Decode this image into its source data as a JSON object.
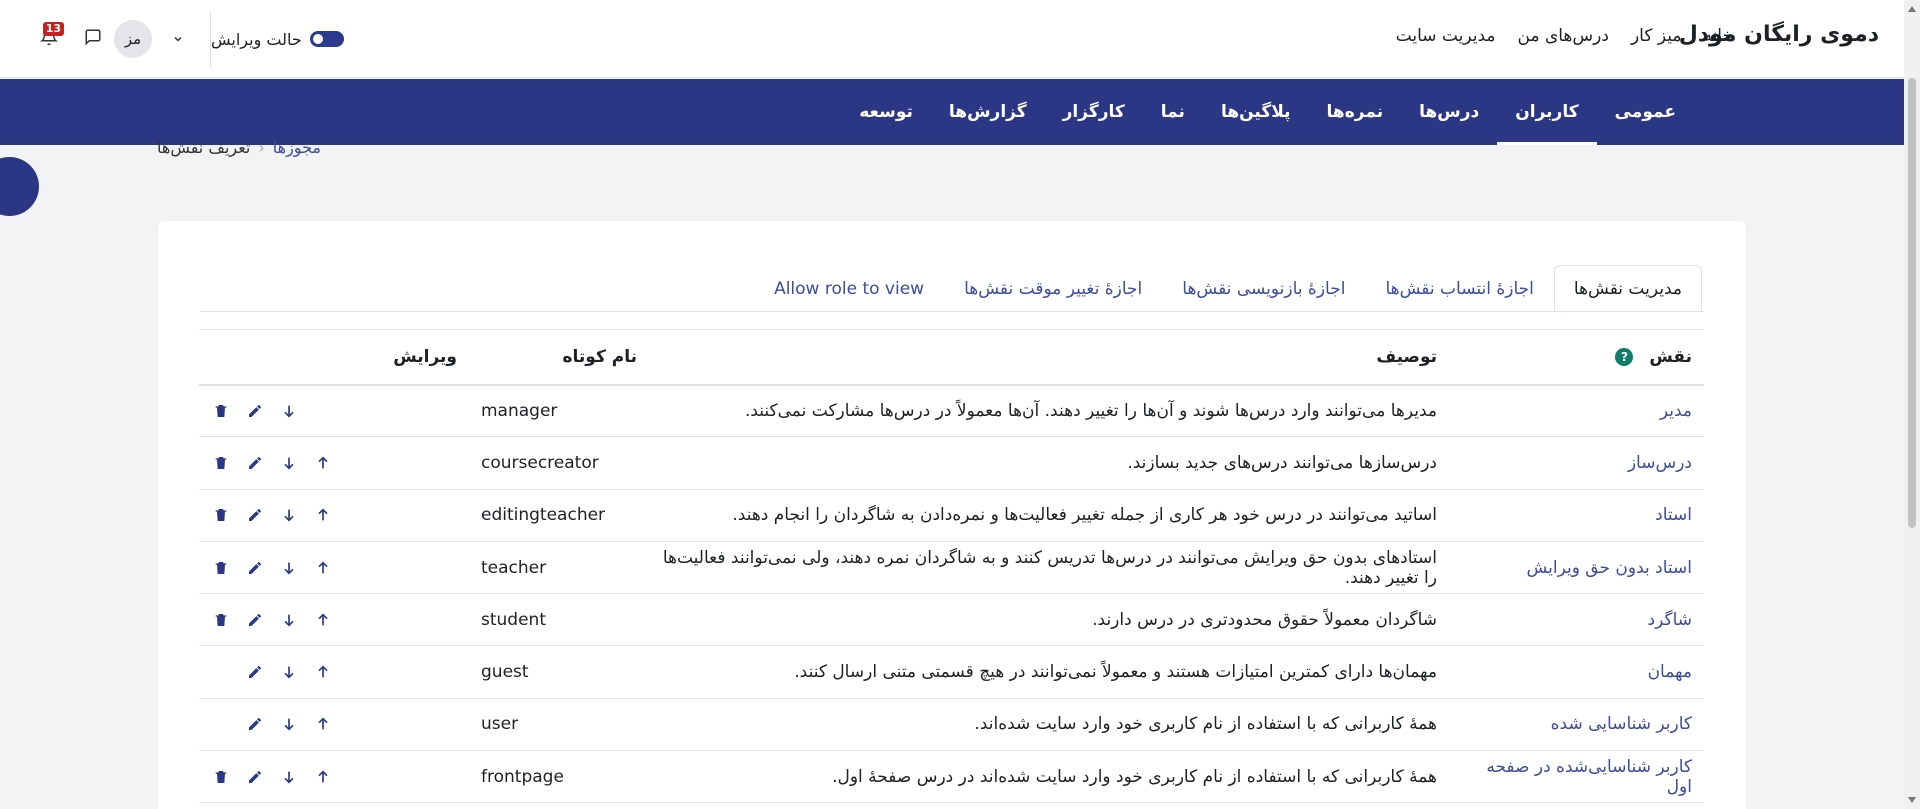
{
  "site": {
    "brand": "دموی رایگان مودل"
  },
  "primary_nav": [
    {
      "label": "خانه"
    },
    {
      "label": "میز کار"
    },
    {
      "label": "درس‌های من"
    },
    {
      "label": "مدیریت سایت"
    }
  ],
  "user": {
    "initials": "مز",
    "notification_count": "13",
    "edit_mode_label": "حالت ویرایش"
  },
  "secondary_nav": [
    {
      "label": "عمومی",
      "active": false
    },
    {
      "label": "کاربران",
      "active": true
    },
    {
      "label": "درس‌ها",
      "active": false
    },
    {
      "label": "نمره‌ها",
      "active": false
    },
    {
      "label": "پلاگین‌ها",
      "active": false
    },
    {
      "label": "نما",
      "active": false
    },
    {
      "label": "کارگزار",
      "active": false
    },
    {
      "label": "گزارش‌ها",
      "active": false
    },
    {
      "label": "توسعه",
      "active": false
    }
  ],
  "breadcrumb": {
    "parent": "مجوزها",
    "current": "تعریف نقش‌ها"
  },
  "tabs": [
    {
      "label": "مدیریت نقش‌ها",
      "active": true
    },
    {
      "label": "اجازهٔ انتساب نقش‌ها",
      "active": false
    },
    {
      "label": "اجازهٔ بازنویسی نقش‌ها",
      "active": false
    },
    {
      "label": "اجازهٔ تغییر موقت نقش‌ها",
      "active": false
    },
    {
      "label": "Allow role to view",
      "active": false
    }
  ],
  "table": {
    "headers": {
      "role": "نقش",
      "description": "توصیف",
      "shortname": "نام کوتاه",
      "edit": "ویرایش"
    },
    "rows": [
      {
        "role": "مدیر",
        "description": "مدیرها می‌توانند وارد درس‌ها شوند و آن‌ها را تغییر دهند. آن‌ها معمولاً در درس‌ها مشارکت نمی‌کنند.",
        "shortname": "manager",
        "up": false,
        "down": true,
        "delete": true
      },
      {
        "role": "درس‌ساز",
        "description": "درس‌سازها می‌توانند درس‌های جدید بسازند.",
        "shortname": "coursecreator",
        "up": true,
        "down": true,
        "delete": true
      },
      {
        "role": "استاد",
        "description": "اساتید می‌توانند در درس خود هر کاری از جمله تغییر فعالیت‌ها و نمره‌دادن به شاگردان را انجام دهند.",
        "shortname": "editingteacher",
        "up": true,
        "down": true,
        "delete": true
      },
      {
        "role": "استاد بدون حق ویرایش",
        "description": "استادهای بدون حق ویرایش می‌توانند در درس‌ها تدریس کنند و به شاگردان نمره دهند، ولی نمی‌توانند فعالیت‌ها را تغییر دهند.",
        "shortname": "teacher",
        "up": true,
        "down": true,
        "delete": true
      },
      {
        "role": "شاگرد",
        "description": "شاگردان معمولاً حقوق محدودتری در درس دارند.",
        "shortname": "student",
        "up": true,
        "down": true,
        "delete": true
      },
      {
        "role": "مهمان",
        "description": "مهمان‌ها دارای کمترین امتیازات هستند و معمولاً نمی‌توانند در هیچ قسمتی متنی ارسال کنند.",
        "shortname": "guest",
        "up": true,
        "down": true,
        "delete": false
      },
      {
        "role": "کاربر شناسایی شده",
        "description": "همهٔ کاربرانی که با استفاده از نام کاربری خود وارد سایت شده‌اند.",
        "shortname": "user",
        "up": true,
        "down": true,
        "delete": false
      },
      {
        "role": "کاربر شناسایی‌شده در صفحه اول",
        "description": "همهٔ کاربرانی که با استفاده از نام کاربری خود وارد سایت شده‌اند در درس صفحهٔ اول.",
        "shortname": "frontpage",
        "up": true,
        "down": true,
        "delete": true
      }
    ]
  },
  "colors": {
    "primary": "#2b3785",
    "link": "#3d4c9e",
    "badge": "#c5221f",
    "help": "#0f7d6a"
  }
}
